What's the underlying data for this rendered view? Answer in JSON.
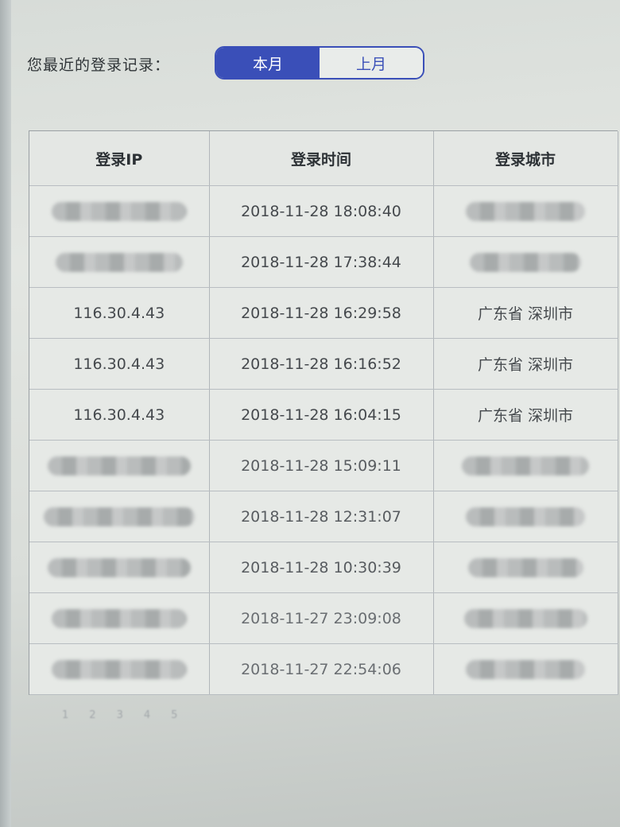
{
  "header": {
    "label": "您最近的登录记录：",
    "tabs": [
      {
        "label": "本月",
        "active": true
      },
      {
        "label": "上月",
        "active": false
      }
    ]
  },
  "table": {
    "columns": [
      "登录IP",
      "登录时间",
      "登录城市"
    ],
    "rows": [
      {
        "ip": "",
        "time": "2018-11-28 18:08:40",
        "city": ""
      },
      {
        "ip": "",
        "time": "2018-11-28 17:38:44",
        "city": ""
      },
      {
        "ip": "116.30.4.43",
        "time": "2018-11-28 16:29:58",
        "city": "广东省 深圳市"
      },
      {
        "ip": "116.30.4.43",
        "time": "2018-11-28 16:16:52",
        "city": "广东省 深圳市"
      },
      {
        "ip": "116.30.4.43",
        "time": "2018-11-28 16:04:15",
        "city": "广东省 深圳市"
      },
      {
        "ip": "",
        "time": "2018-11-28 15:09:11",
        "city": ""
      },
      {
        "ip": "",
        "time": "2018-11-28 12:31:07",
        "city": ""
      },
      {
        "ip": "",
        "time": "2018-11-28 10:30:39",
        "city": ""
      },
      {
        "ip": "",
        "time": "2018-11-27 23:09:08",
        "city": ""
      },
      {
        "ip": "",
        "time": "2018-11-27 22:54:06",
        "city": ""
      }
    ]
  },
  "pagination": {
    "pages": [
      "1",
      "2",
      "3",
      "4",
      "5"
    ]
  },
  "colors": {
    "accent": "#3a4fb8",
    "active_text": "#ffffff"
  }
}
